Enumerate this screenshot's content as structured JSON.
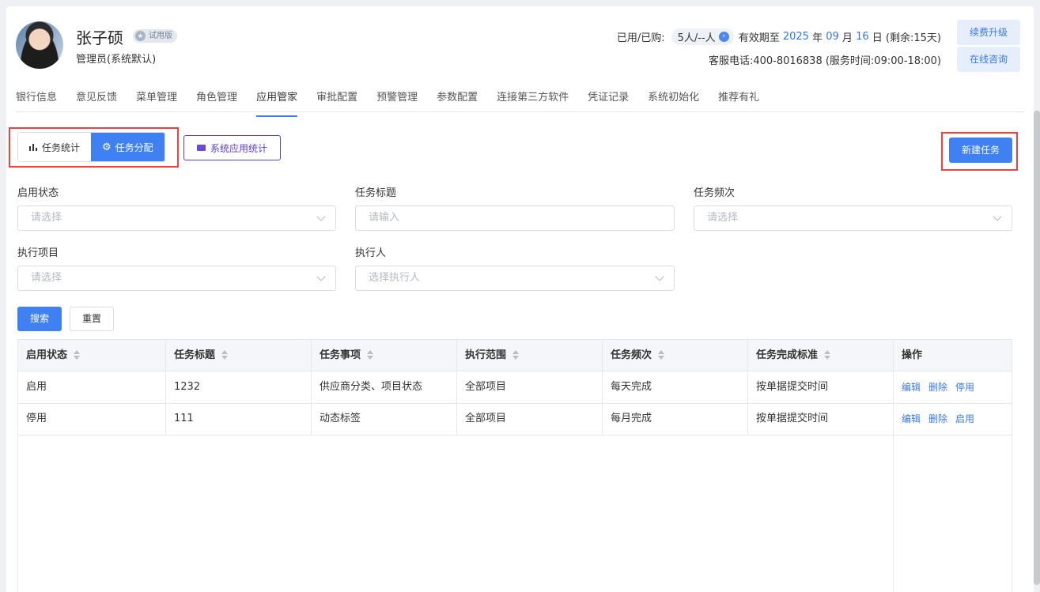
{
  "user": {
    "name": "张子硕",
    "badge": "试用版",
    "role": "管理员(系统默认)"
  },
  "account": {
    "usage_label": "已用/已购:",
    "usage_value": "5人/--人",
    "valid_prefix": "有效期至",
    "year": "2025",
    "year_unit": "年",
    "month": "09",
    "month_unit": "月",
    "day": "16",
    "day_unit": "日",
    "remaining": "(剩余:15天)",
    "service_phone": "客服电话:400-8016838 (服务时间:09:00-18:00)",
    "renew_label": "续费升级",
    "consult_label": "在线咨询"
  },
  "tabs": [
    {
      "label": "银行信息",
      "active": false
    },
    {
      "label": "意见反馈",
      "active": false
    },
    {
      "label": "菜单管理",
      "active": false
    },
    {
      "label": "角色管理",
      "active": false
    },
    {
      "label": "应用管家",
      "active": true
    },
    {
      "label": "审批配置",
      "active": false
    },
    {
      "label": "预警管理",
      "active": false
    },
    {
      "label": "参数配置",
      "active": false
    },
    {
      "label": "连接第三方软件",
      "active": false
    },
    {
      "label": "凭证记录",
      "active": false
    },
    {
      "label": "系统初始化",
      "active": false
    },
    {
      "label": "推荐有礼",
      "active": false
    }
  ],
  "toolbar": {
    "stats_label": "任务统计",
    "assign_label": "任务分配",
    "sys_stats_label": "系统应用统计",
    "new_task_label": "新建任务"
  },
  "filters": {
    "status_label": "启用状态",
    "status_placeholder": "请选择",
    "title_label": "任务标题",
    "title_placeholder": "请输入",
    "freq_label": "任务频次",
    "freq_placeholder": "请选择",
    "project_label": "执行项目",
    "project_placeholder": "请选择",
    "executor_label": "执行人",
    "executor_placeholder": "选择执行人",
    "search_label": "搜索",
    "reset_label": "重置"
  },
  "table": {
    "headers": [
      "启用状态",
      "任务标题",
      "任务事项",
      "执行范围",
      "任务频次",
      "任务完成标准",
      "操作"
    ],
    "rows": [
      {
        "status": "启用",
        "title": "1232",
        "item": "供应商分类、项目状态",
        "scope": "全部项目",
        "freq": "每天完成",
        "standard": "按单据提交时间",
        "ops": [
          "编辑",
          "删除",
          "停用"
        ]
      },
      {
        "status": "停用",
        "title": "111",
        "item": "动态标签",
        "scope": "全部项目",
        "freq": "每月完成",
        "standard": "按单据提交时间",
        "ops": [
          "编辑",
          "删除",
          "启用"
        ]
      }
    ]
  },
  "colors": {
    "primary": "#3f81f2",
    "highlight_box": "#e8433f",
    "link": "#3a78ea"
  }
}
